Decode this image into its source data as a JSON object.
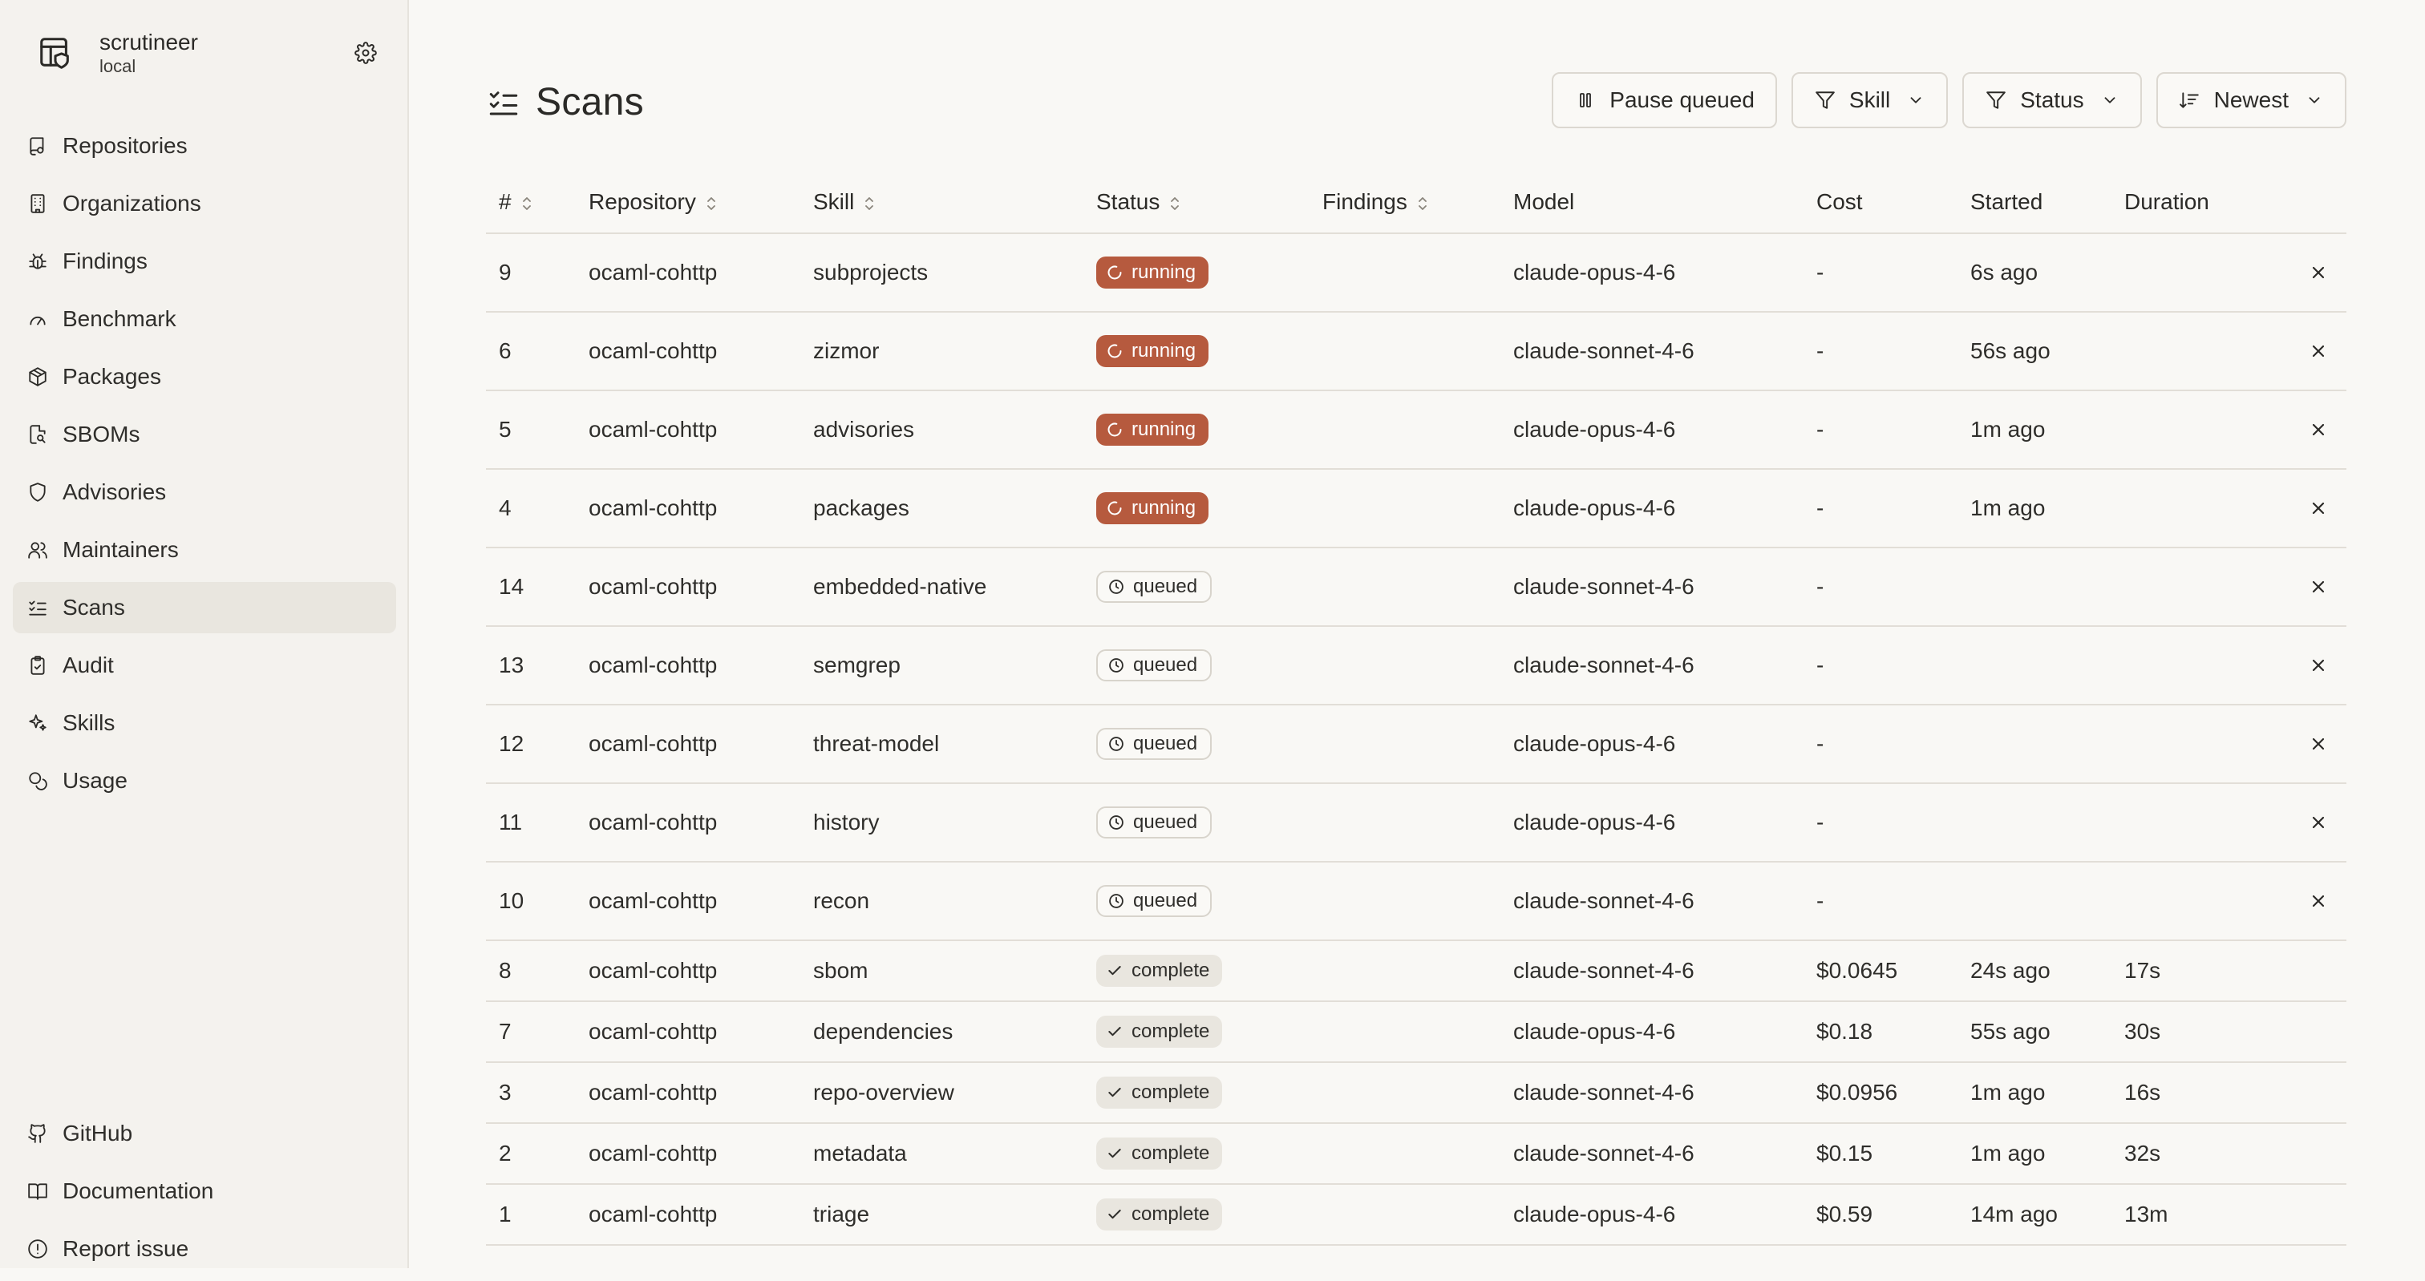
{
  "brand": {
    "name": "scrutineer",
    "subtitle": "local"
  },
  "sidebar": {
    "items": [
      {
        "label": "Repositories",
        "icon": "repo-icon"
      },
      {
        "label": "Organizations",
        "icon": "building-icon"
      },
      {
        "label": "Findings",
        "icon": "bug-icon"
      },
      {
        "label": "Benchmark",
        "icon": "gauge-icon"
      },
      {
        "label": "Packages",
        "icon": "package-icon"
      },
      {
        "label": "SBOMs",
        "icon": "file-search-icon"
      },
      {
        "label": "Advisories",
        "icon": "shield-icon"
      },
      {
        "label": "Maintainers",
        "icon": "users-icon"
      },
      {
        "label": "Scans",
        "icon": "list-checks-icon",
        "active": true
      },
      {
        "label": "Audit",
        "icon": "clipboard-check-icon"
      },
      {
        "label": "Skills",
        "icon": "sparkles-icon"
      },
      {
        "label": "Usage",
        "icon": "coins-icon"
      }
    ],
    "footer": [
      {
        "label": "GitHub",
        "icon": "github-icon"
      },
      {
        "label": "Documentation",
        "icon": "book-icon"
      },
      {
        "label": "Report issue",
        "icon": "alert-circle-icon"
      }
    ]
  },
  "page": {
    "title": "Scans",
    "toolbar": {
      "pause_label": "Pause queued",
      "skill_label": "Skill",
      "status_label": "Status",
      "sort_label": "Newest"
    }
  },
  "table": {
    "columns": [
      "#",
      "Repository",
      "Skill",
      "Status",
      "Findings",
      "Model",
      "Cost",
      "Started",
      "Duration"
    ],
    "rows": [
      {
        "id": "9",
        "repo": "ocaml-cohttp",
        "skill": "subprojects",
        "status": "running",
        "findings": "",
        "model": "claude-opus-4-6",
        "cost": "-",
        "started": "6s ago",
        "duration": ""
      },
      {
        "id": "6",
        "repo": "ocaml-cohttp",
        "skill": "zizmor",
        "status": "running",
        "findings": "",
        "model": "claude-sonnet-4-6",
        "cost": "-",
        "started": "56s ago",
        "duration": ""
      },
      {
        "id": "5",
        "repo": "ocaml-cohttp",
        "skill": "advisories",
        "status": "running",
        "findings": "",
        "model": "claude-opus-4-6",
        "cost": "-",
        "started": "1m ago",
        "duration": ""
      },
      {
        "id": "4",
        "repo": "ocaml-cohttp",
        "skill": "packages",
        "status": "running",
        "findings": "",
        "model": "claude-opus-4-6",
        "cost": "-",
        "started": "1m ago",
        "duration": ""
      },
      {
        "id": "14",
        "repo": "ocaml-cohttp",
        "skill": "embedded-native",
        "status": "queued",
        "findings": "",
        "model": "claude-sonnet-4-6",
        "cost": "-",
        "started": "",
        "duration": ""
      },
      {
        "id": "13",
        "repo": "ocaml-cohttp",
        "skill": "semgrep",
        "status": "queued",
        "findings": "",
        "model": "claude-sonnet-4-6",
        "cost": "-",
        "started": "",
        "duration": ""
      },
      {
        "id": "12",
        "repo": "ocaml-cohttp",
        "skill": "threat-model",
        "status": "queued",
        "findings": "",
        "model": "claude-opus-4-6",
        "cost": "-",
        "started": "",
        "duration": ""
      },
      {
        "id": "11",
        "repo": "ocaml-cohttp",
        "skill": "history",
        "status": "queued",
        "findings": "",
        "model": "claude-opus-4-6",
        "cost": "-",
        "started": "",
        "duration": ""
      },
      {
        "id": "10",
        "repo": "ocaml-cohttp",
        "skill": "recon",
        "status": "queued",
        "findings": "",
        "model": "claude-sonnet-4-6",
        "cost": "-",
        "started": "",
        "duration": ""
      },
      {
        "id": "8",
        "repo": "ocaml-cohttp",
        "skill": "sbom",
        "status": "complete",
        "findings": "",
        "model": "claude-sonnet-4-6",
        "cost": "$0.0645",
        "started": "24s ago",
        "duration": "17s"
      },
      {
        "id": "7",
        "repo": "ocaml-cohttp",
        "skill": "dependencies",
        "status": "complete",
        "findings": "",
        "model": "claude-opus-4-6",
        "cost": "$0.18",
        "started": "55s ago",
        "duration": "30s"
      },
      {
        "id": "3",
        "repo": "ocaml-cohttp",
        "skill": "repo-overview",
        "status": "complete",
        "findings": "",
        "model": "claude-sonnet-4-6",
        "cost": "$0.0956",
        "started": "1m ago",
        "duration": "16s"
      },
      {
        "id": "2",
        "repo": "ocaml-cohttp",
        "skill": "metadata",
        "status": "complete",
        "findings": "",
        "model": "claude-sonnet-4-6",
        "cost": "$0.15",
        "started": "1m ago",
        "duration": "32s"
      },
      {
        "id": "1",
        "repo": "ocaml-cohttp",
        "skill": "triage",
        "status": "complete",
        "findings": "",
        "model": "claude-opus-4-6",
        "cost": "$0.59",
        "started": "14m ago",
        "duration": "13m"
      }
    ]
  },
  "colors": {
    "running": "#b65a3e",
    "complete_bg": "#e9e6df",
    "sidebar_bg": "#f4f2ee",
    "page_bg": "#f9f8f5"
  }
}
